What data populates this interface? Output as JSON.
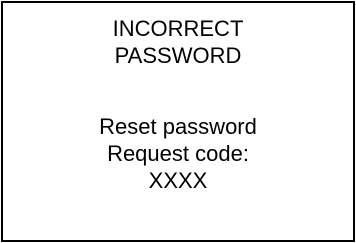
{
  "error": {
    "line1": "INCORRECT",
    "line2": "PASSWORD"
  },
  "reset": {
    "title": "Reset password",
    "request_label": "Request code:",
    "code": "XXXX"
  }
}
